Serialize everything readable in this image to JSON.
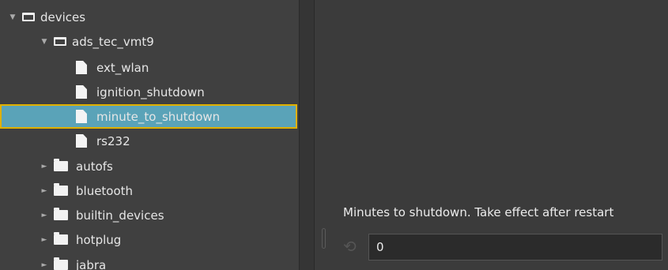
{
  "tree": {
    "devices": {
      "label": "devices",
      "arrow": "▼"
    },
    "ads_tec_vmt9": {
      "label": "ads_tec_vmt9",
      "arrow": "▼"
    },
    "files": [
      {
        "label": "ext_wlan"
      },
      {
        "label": "ignition_shutdown"
      },
      {
        "label": "minute_to_shutdown",
        "selected": true
      },
      {
        "label": "rs232"
      }
    ],
    "folders": [
      {
        "label": "autofs",
        "arrow": "►"
      },
      {
        "label": "bluetooth",
        "arrow": "►"
      },
      {
        "label": "builtin_devices",
        "arrow": "►"
      },
      {
        "label": "hotplug",
        "arrow": "►"
      },
      {
        "label": "jabra",
        "arrow": "►"
      }
    ]
  },
  "detail": {
    "description": "Minutes to shutdown. Take effect after restart",
    "value": "0"
  },
  "colors": {
    "selection_bg": "#5aa3b8",
    "selection_border": "#e0b000",
    "panel_bg": "#404040"
  },
  "icons": {
    "reset": "reset-icon",
    "file": "file-icon",
    "folder": "folder-icon"
  }
}
